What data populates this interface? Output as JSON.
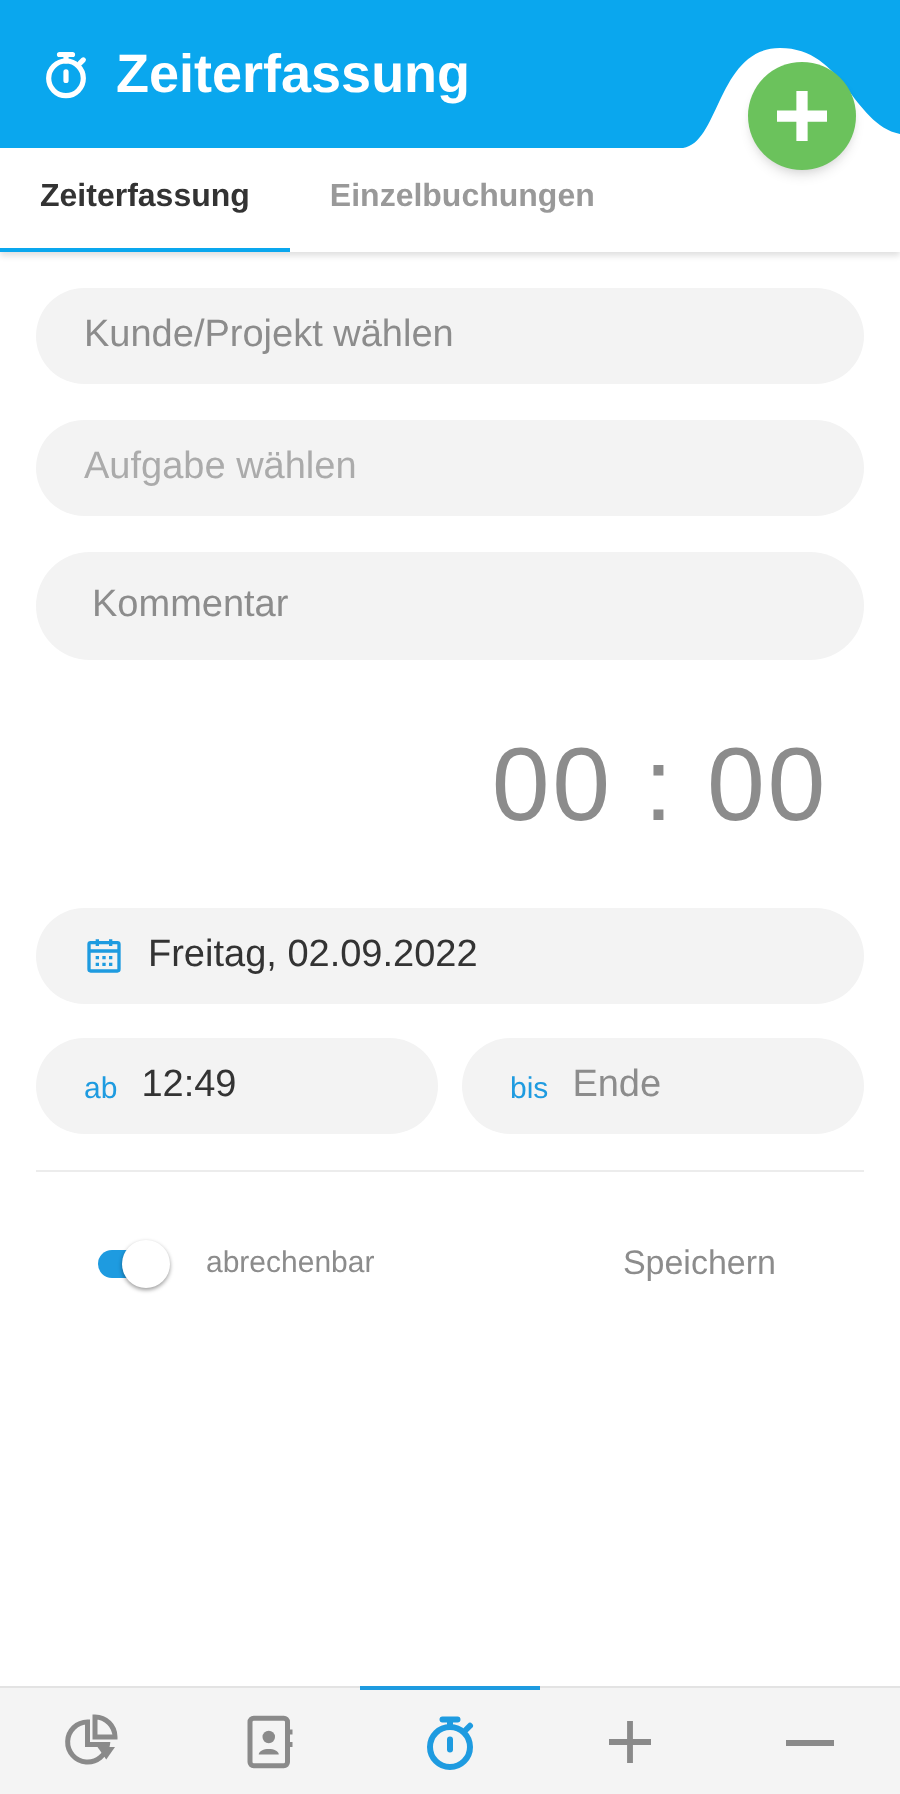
{
  "header": {
    "title": "Zeiterfassung"
  },
  "tabs": [
    {
      "label": "Zeiterfassung",
      "selected": true
    },
    {
      "label": "Einzelbuchungen",
      "selected": false
    }
  ],
  "fields": [
    {
      "placeholder": "Kunde/Projekt wählen",
      "disabled": false
    },
    {
      "placeholder": "Aufgabe wählen",
      "disabled": true
    },
    {
      "placeholder": "Kommentar",
      "disabled": false
    }
  ],
  "timer": "00 : 00",
  "date": "Freitag, 02.09.2022",
  "from": {
    "label": "ab",
    "value": "12:49"
  },
  "to": {
    "label": "bis",
    "placeholder": "Ende"
  },
  "billable": {
    "label": "abrechenbar",
    "on": true
  },
  "save": "Speichern",
  "nav": [
    {
      "kind": "chart",
      "selected": false
    },
    {
      "kind": "contacts",
      "selected": false
    },
    {
      "kind": "timer",
      "selected": true
    },
    {
      "kind": "plus",
      "selected": false
    },
    {
      "kind": "minus",
      "selected": false
    }
  ]
}
